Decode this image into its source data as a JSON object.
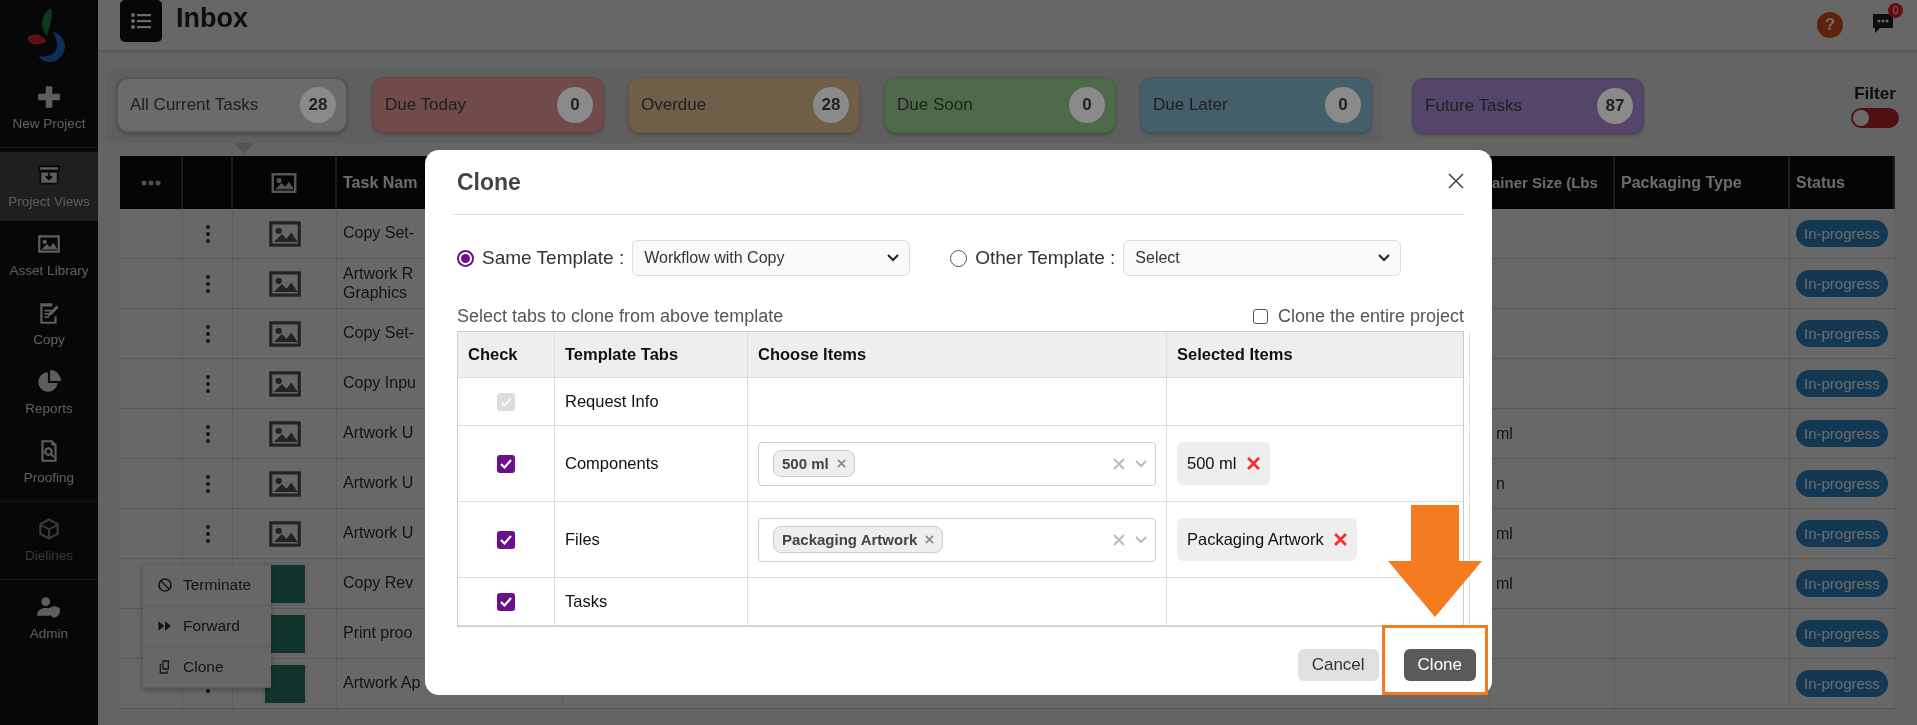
{
  "sidebar": {
    "items": [
      {
        "label": "New Project",
        "selected": false,
        "disabled": false
      },
      {
        "label": "Project Views",
        "selected": true,
        "disabled": false
      },
      {
        "label": "Asset Library",
        "selected": false,
        "disabled": false
      },
      {
        "label": "Copy",
        "selected": false,
        "disabled": false
      },
      {
        "label": "Reports",
        "selected": false,
        "disabled": false
      },
      {
        "label": "Proofing",
        "selected": false,
        "disabled": false
      },
      {
        "label": "Dielines",
        "selected": false,
        "disabled": true
      },
      {
        "label": "Admin",
        "selected": false,
        "disabled": false
      }
    ]
  },
  "header": {
    "title": "Inbox",
    "help_label": "?",
    "notification_count": "0"
  },
  "summary_cards": [
    {
      "label": "All Current Tasks",
      "count": "28",
      "color": "#6b6b6b",
      "selected": true
    },
    {
      "label": "Due Today",
      "count": "0",
      "color": "#714a4a",
      "selected": false
    },
    {
      "label": "Overdue",
      "count": "28",
      "color": "#6f5f48",
      "selected": false
    },
    {
      "label": "Due Soon",
      "count": "0",
      "color": "#4f6a4b",
      "selected": false
    },
    {
      "label": "Due Later",
      "count": "0",
      "color": "#445f6a",
      "selected": false
    },
    {
      "label": "Future Tasks",
      "count": "87",
      "color": "#54466a",
      "selected": false
    }
  ],
  "filter": {
    "label": "Filter",
    "on": false
  },
  "task_table": {
    "columns": [
      "Task Nam",
      "ainer Size (Lbs",
      "Packaging Type",
      "Status"
    ],
    "rows": [
      {
        "kind": "placeholder",
        "task_name": "Copy Set-",
        "column_5": "",
        "status": "In-progress"
      },
      {
        "kind": "placeholder",
        "task_name": "Artwork R\nGraphics",
        "column_5": "",
        "status": "In-progress"
      },
      {
        "kind": "placeholder",
        "task_name": "Copy Set-",
        "column_5": "",
        "status": "In-progress"
      },
      {
        "kind": "placeholder",
        "task_name": "Copy Inpu",
        "column_5": "",
        "status": "In-progress"
      },
      {
        "kind": "placeholder",
        "task_name": "Artwork U",
        "column_5": "ml",
        "status": "In-progress"
      },
      {
        "kind": "placeholder",
        "task_name": "Artwork U",
        "column_5": "n",
        "status": "In-progress"
      },
      {
        "kind": "placeholder",
        "task_name": "Artwork U",
        "column_5": "ml",
        "status": "In-progress"
      },
      {
        "kind": "artwork",
        "task_name": "Copy Rev",
        "column_5": "ml",
        "status": "In-progress"
      },
      {
        "kind": "artwork",
        "task_name": "Print proo",
        "column_5": "",
        "status": "In-progress"
      },
      {
        "kind": "artwork",
        "task_name": "Artwork Ap",
        "column_5": "",
        "status": "In-progress"
      }
    ]
  },
  "row_menu": {
    "items": [
      {
        "label": "Terminate"
      },
      {
        "label": "Forward"
      },
      {
        "label": "Clone"
      }
    ]
  },
  "clone_dialog": {
    "title": "Clone",
    "template_options": [
      {
        "label": "Same Template :",
        "selected": true,
        "value": "Workflow with Copy"
      },
      {
        "label": "Other Template :",
        "selected": false,
        "value": "Select"
      }
    ],
    "instructions": "Select tabs to clone from above template",
    "clone_entire_project": {
      "label": "Clone the entire project",
      "checked": false
    },
    "columns": [
      "Check",
      "Template Tabs",
      "Choose Items",
      "Selected Items"
    ],
    "rows": [
      {
        "tab": "Request Info",
        "checked": true,
        "disabled": true,
        "chosen": [],
        "selected_items": []
      },
      {
        "tab": "Components",
        "checked": true,
        "disabled": false,
        "chosen": [
          "500 ml"
        ],
        "selected_items": [
          "500 ml"
        ]
      },
      {
        "tab": "Files",
        "checked": true,
        "disabled": false,
        "chosen": [
          "Packaging Artwork"
        ],
        "selected_items": [
          "Packaging Artwork"
        ]
      },
      {
        "tab": "Tasks",
        "checked": true,
        "disabled": false,
        "chosen": [],
        "selected_items": []
      }
    ],
    "buttons": [
      {
        "label": "Cancel",
        "kind": "secondary",
        "highlighted": false
      },
      {
        "label": "Clone",
        "kind": "primary",
        "highlighted": true
      }
    ]
  }
}
